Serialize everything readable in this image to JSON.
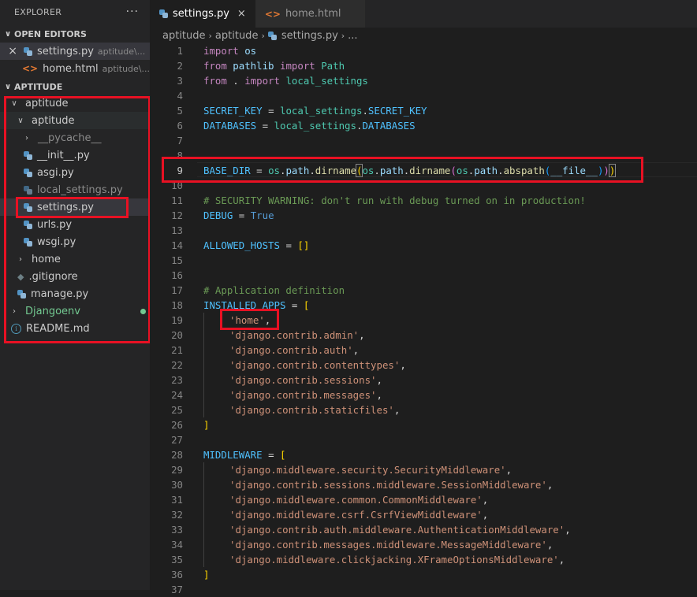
{
  "explorer": {
    "title": "EXPLORER",
    "more": "···",
    "open_editors_title": "OPEN EDITORS",
    "open_editors": [
      {
        "name": "settings.py",
        "hint": "aptitude\\..."
      },
      {
        "name": "home.html",
        "hint": "aptitude\\..."
      }
    ],
    "workspace_title": "APTITUDE",
    "tree": {
      "root": "aptitude",
      "inner": "aptitude",
      "pycache": "__pycache__",
      "init": "__init__.py",
      "asgi": "asgi.py",
      "local_settings": "local_settings.py",
      "settings": "settings.py",
      "urls": "urls.py",
      "wsgi": "wsgi.py",
      "home": "home",
      "gitignore": ".gitignore",
      "manage": "manage.py",
      "djangoenv": "Djangoenv",
      "readme": "README.md"
    }
  },
  "tabs": [
    {
      "label": "settings.py",
      "close": "×"
    },
    {
      "label": "home.html"
    }
  ],
  "breadcrumb": {
    "a": "aptitude",
    "b": "aptitude",
    "c": "settings.py",
    "d": "..."
  },
  "editor": {
    "line_numbers": [
      "1",
      "2",
      "3",
      "4",
      "5",
      "6",
      "7",
      "8",
      "9",
      "10",
      "11",
      "12",
      "13",
      "14",
      "15",
      "16",
      "17",
      "18",
      "19",
      "20",
      "21",
      "22",
      "23",
      "24",
      "25",
      "26",
      "27",
      "28",
      "29",
      "30",
      "31",
      "32",
      "33",
      "34",
      "35",
      "36",
      "37"
    ],
    "lines": {
      "l1": [
        "import",
        " os"
      ],
      "l2": [
        "from",
        " pathlib ",
        "import",
        " Path"
      ],
      "l3": [
        "from",
        " . ",
        "import",
        " local_settings"
      ],
      "l5": [
        "SECRET_KEY",
        " = ",
        "local_settings",
        ".",
        "SECRET_KEY"
      ],
      "l6": [
        "DATABASES",
        " = ",
        "local_settings",
        ".",
        "DATABASES"
      ],
      "l9": [
        "BASE_DIR",
        " = ",
        "os",
        ".",
        "path",
        ".",
        "dirname",
        "(",
        "os",
        ".",
        "path",
        ".",
        "dirname",
        "(",
        "os",
        ".",
        "path",
        ".",
        "abspath",
        "(",
        "__file__",
        ")",
        ")",
        ")"
      ],
      "l11": "# SECURITY WARNING: don't run with debug turned on in production!",
      "l12": [
        "DEBUG",
        " = ",
        "True"
      ],
      "l14": [
        "ALLOWED_HOSTS",
        " = ",
        "[]"
      ],
      "l17": "# Application definition",
      "l18": [
        "INSTALLED_APPS",
        " = ",
        "["
      ],
      "l19": [
        "'home'",
        ","
      ],
      "l20": [
        "'django.contrib.admin'",
        ","
      ],
      "l21": [
        "'django.contrib.auth'",
        ","
      ],
      "l22": [
        "'django.contrib.contenttypes'",
        ","
      ],
      "l23": [
        "'django.contrib.sessions'",
        ","
      ],
      "l24": [
        "'django.contrib.messages'",
        ","
      ],
      "l25": [
        "'django.contrib.staticfiles'",
        ","
      ],
      "l26": "]",
      "l28": [
        "MIDDLEWARE",
        " = ",
        "["
      ],
      "l29": [
        "'django.middleware.security.SecurityMiddleware'",
        ","
      ],
      "l30": [
        "'django.contrib.sessions.middleware.SessionMiddleware'",
        ","
      ],
      "l31": [
        "'django.middleware.common.CommonMiddleware'",
        ","
      ],
      "l32": [
        "'django.middleware.csrf.CsrfViewMiddleware'",
        ","
      ],
      "l33": [
        "'django.contrib.auth.middleware.AuthenticationMiddleware'",
        ","
      ],
      "l34": [
        "'django.contrib.messages.middleware.MessageMiddleware'",
        ","
      ],
      "l35": [
        "'django.middleware.clickjacking.XFrameOptionsMiddleware'",
        ","
      ],
      "l36": "]"
    }
  },
  "colors": {
    "highlight_box": "#e81123",
    "sidebar_bg": "#252526",
    "editor_bg": "#1e1e1e"
  }
}
